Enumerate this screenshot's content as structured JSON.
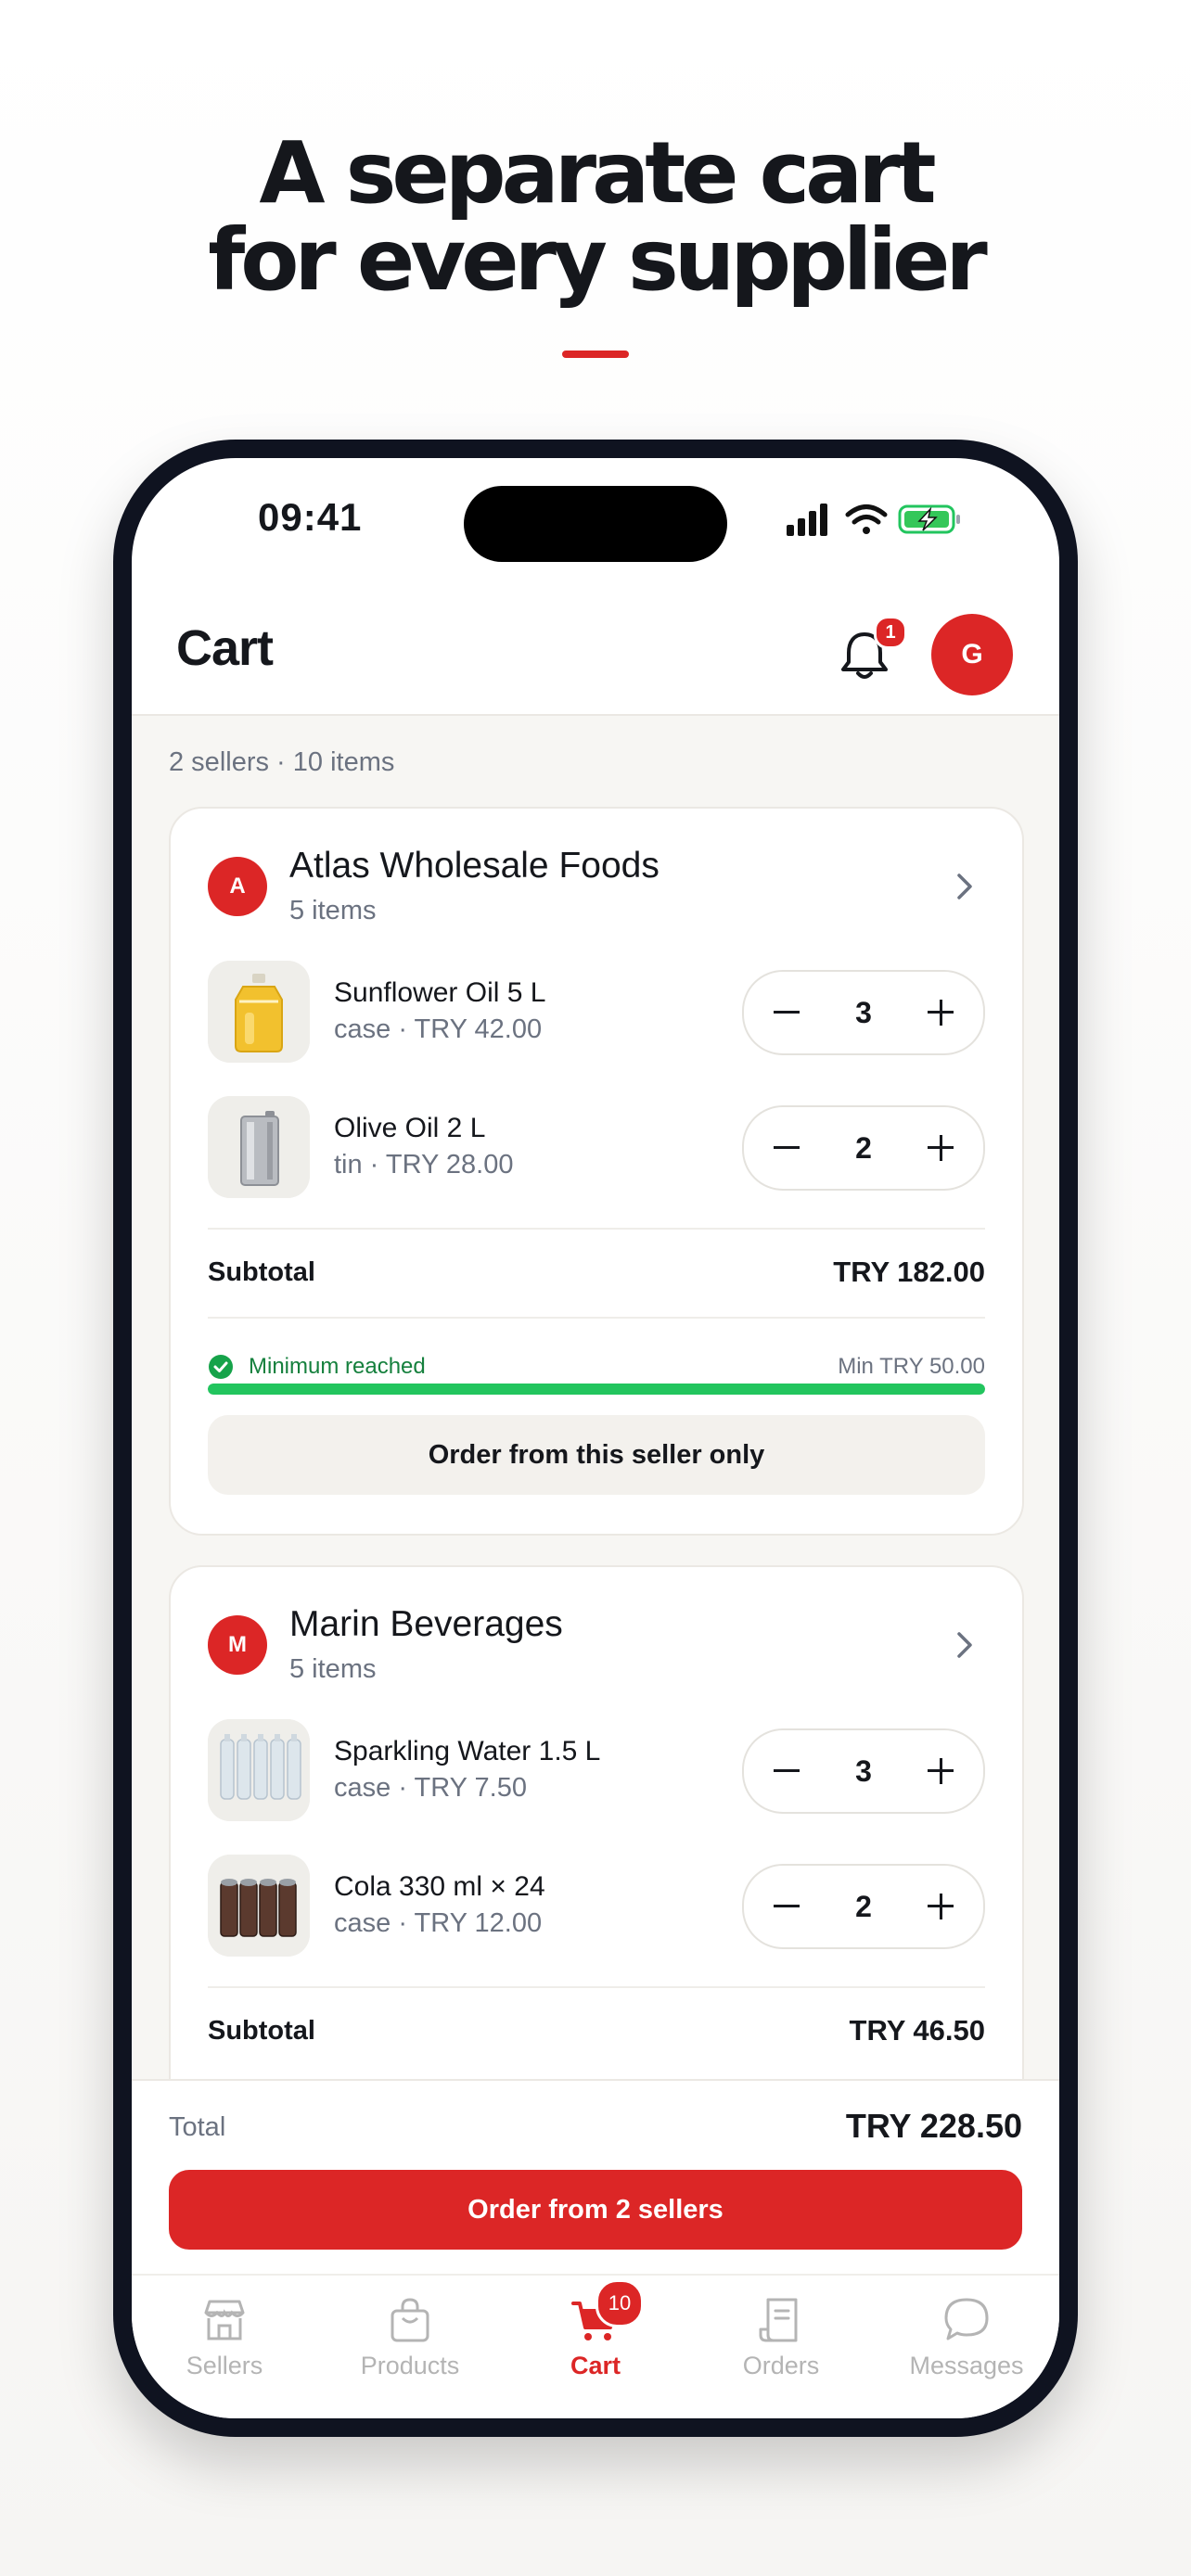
{
  "marketing": {
    "headline_line1": "A separate cart",
    "headline_line2": "for every supplier",
    "accent_color": "#dc2626"
  },
  "status_bar": {
    "time": "09:41",
    "icons": [
      "signal-icon",
      "wifi-icon",
      "battery-charging-icon"
    ]
  },
  "header": {
    "title": "Cart",
    "notification_count": "1",
    "user_initial": "G"
  },
  "cart": {
    "summary": "2 sellers · 10 items",
    "sellers": [
      {
        "initial": "A",
        "name": "Atlas Wholesale Foods",
        "item_count": "5 items",
        "items": [
          {
            "name": "Sunflower Oil 5 L",
            "unit_price": "case · TRY 42.00",
            "qty": "3",
            "icon": "sunflower-oil-bottle"
          },
          {
            "name": "Olive Oil 2 L",
            "unit_price": "tin · TRY 28.00",
            "qty": "2",
            "icon": "olive-oil-tin"
          }
        ],
        "subtotal_label": "Subtotal",
        "subtotal": "TRY 182.00",
        "minimum_status": "Minimum reached",
        "minimum_required": "Min TRY 50.00",
        "minimum_progress": 1.0,
        "order_button": "Order from this seller only"
      },
      {
        "initial": "M",
        "name": "Marin Beverages",
        "item_count": "5 items",
        "items": [
          {
            "name": "Sparkling Water 1.5 L",
            "unit_price": "case · TRY 7.50",
            "qty": "3",
            "icon": "water-bottles"
          },
          {
            "name": "Cola 330 ml × 24",
            "unit_price": "case · TRY 12.00",
            "qty": "2",
            "icon": "cola-cans"
          }
        ],
        "subtotal_label": "Subtotal",
        "subtotal": "TRY 46.50"
      }
    ]
  },
  "checkout": {
    "total_label": "Total",
    "total": "TRY 228.50",
    "order_all_button": "Order from 2 sellers"
  },
  "tabbar": {
    "tabs": [
      {
        "label": "Sellers",
        "icon": "store-icon"
      },
      {
        "label": "Products",
        "icon": "bag-icon"
      },
      {
        "label": "Cart",
        "icon": "cart-icon",
        "active": true,
        "badge": "10"
      },
      {
        "label": "Orders",
        "icon": "receipt-icon"
      },
      {
        "label": "Messages",
        "icon": "chat-icon"
      }
    ]
  },
  "colors": {
    "brand": "#dc2626",
    "success": "#22c55e",
    "text": "#15171c",
    "muted": "#6b7280"
  }
}
